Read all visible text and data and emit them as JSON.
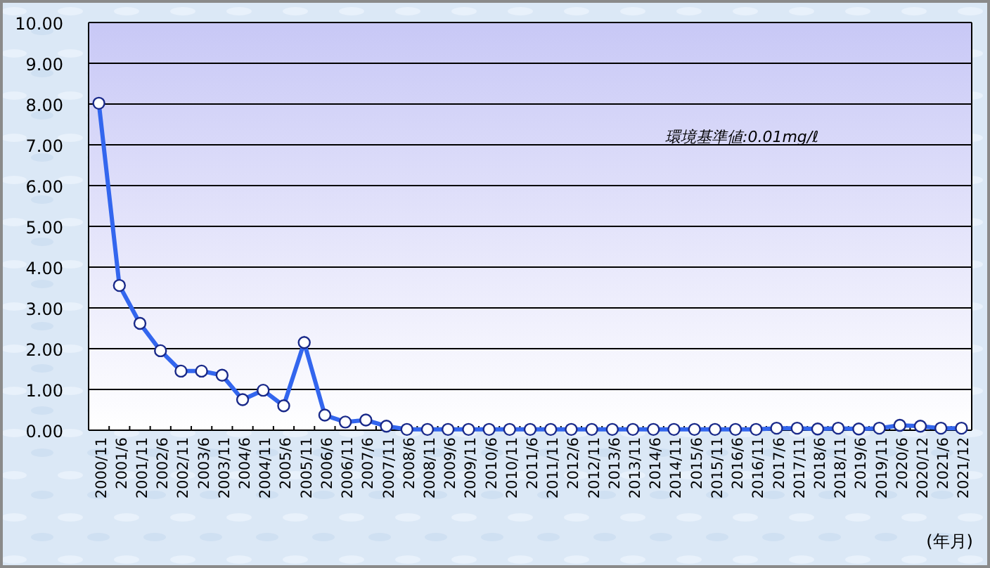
{
  "chart_data": {
    "type": "line",
    "xlabel": "(年月)",
    "annotations": [
      "環境基準値:0.01mg/ℓ"
    ],
    "ylim": [
      0,
      10
    ],
    "yticks": [
      {
        "value": 0,
        "label": "0.00"
      },
      {
        "value": 1,
        "label": "1.00"
      },
      {
        "value": 2,
        "label": "2.00"
      },
      {
        "value": 3,
        "label": "3.00"
      },
      {
        "value": 4,
        "label": "4.00"
      },
      {
        "value": 5,
        "label": "5.00"
      },
      {
        "value": 6,
        "label": "6.00"
      },
      {
        "value": 7,
        "label": "7.00"
      },
      {
        "value": 8,
        "label": "8.00"
      },
      {
        "value": 9,
        "label": "9.00"
      },
      {
        "value": 10,
        "label": "10.00"
      }
    ],
    "categories": [
      "2000/11",
      "2001/6",
      "2001/11",
      "2002/6",
      "2002/11",
      "2003/6",
      "2003/11",
      "2004/6",
      "2004/11",
      "2005/6",
      "2005/11",
      "2006/6",
      "2006/11",
      "2007/6",
      "2007/11",
      "2008/6",
      "2008/11",
      "2009/6",
      "2009/11",
      "2010/6",
      "2010/11",
      "2011/6",
      "2011/11",
      "2012/6",
      "2012/11",
      "2013/6",
      "2013/11",
      "2014/6",
      "2014/11",
      "2015/6",
      "2015/11",
      "2016/6",
      "2016/11",
      "2017/6",
      "2017/11",
      "2018/6",
      "2018/11",
      "2019/6",
      "2019/11",
      "2020/6",
      "2020/12",
      "2021/6",
      "2021/12"
    ],
    "grid": true,
    "series": [
      {
        "color": "#3366ee",
        "marker": "circle",
        "values": [
          8.02,
          3.55,
          2.62,
          1.95,
          1.45,
          1.45,
          1.35,
          0.75,
          0.98,
          0.6,
          2.15,
          0.37,
          0.2,
          0.25,
          0.1,
          0.02,
          0.02,
          0.02,
          0.02,
          0.02,
          0.02,
          0.02,
          0.02,
          0.02,
          0.02,
          0.02,
          0.02,
          0.02,
          0.02,
          0.02,
          0.02,
          0.02,
          0.02,
          0.05,
          0.05,
          0.03,
          0.05,
          0.03,
          0.05,
          0.12,
          0.1,
          0.05,
          0.05
        ]
      }
    ]
  }
}
